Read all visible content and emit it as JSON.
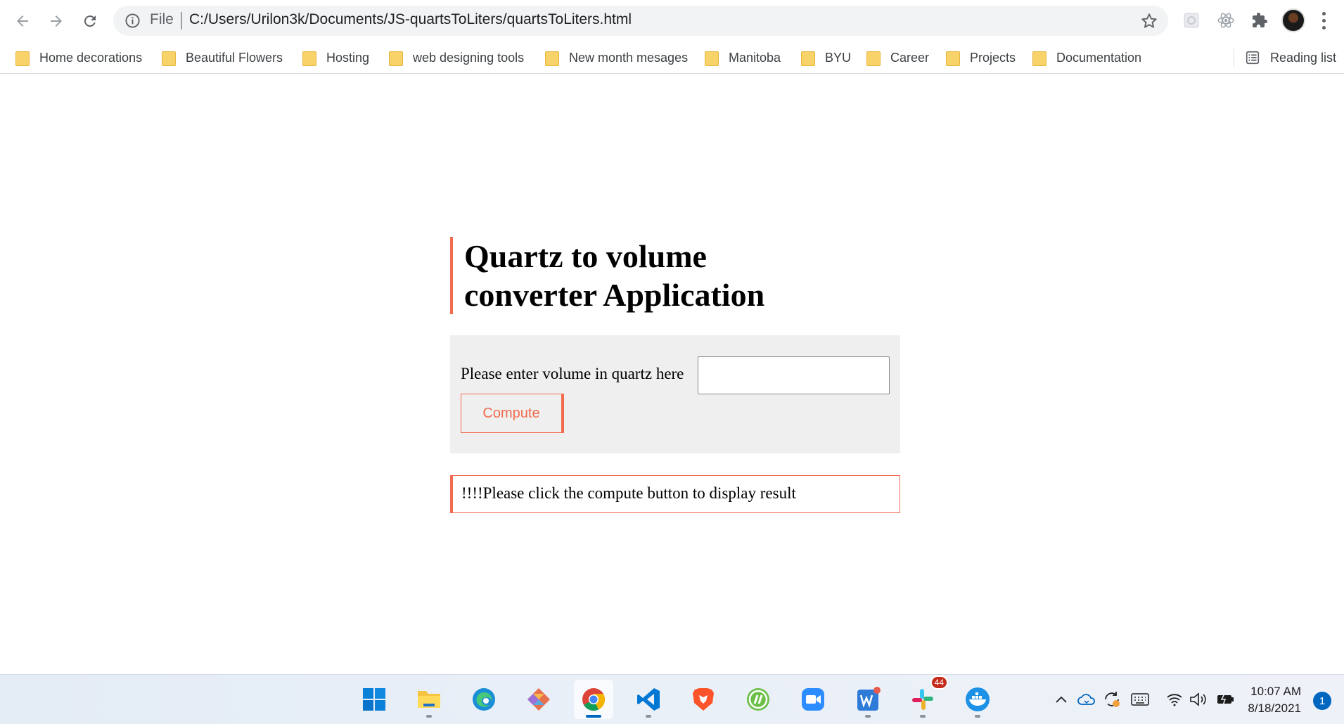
{
  "browser": {
    "omnibox": {
      "scheme_label": "File",
      "url": "C:/Users/Urilon3k/Documents/JS-quartsToLiters/quartsToLiters.html"
    },
    "bookmarks": [
      {
        "label": "Home decorations"
      },
      {
        "label": "Beautiful Flowers"
      },
      {
        "label": "Hosting"
      },
      {
        "label": "web designing tools"
      },
      {
        "label": "New month mesages"
      },
      {
        "label": "Manitoba"
      },
      {
        "label": "BYU"
      },
      {
        "label": "Career"
      },
      {
        "label": "Projects"
      },
      {
        "label": "Documentation"
      }
    ],
    "reading_list_label": "Reading list"
  },
  "page": {
    "title": "Quartz to volume converter Application",
    "form": {
      "label": "Please enter volume in quartz here",
      "input_value": "",
      "compute_label": "Compute"
    },
    "result_text": "!!!!Please click the compute button to display result",
    "accent_color": "#f26b4f"
  },
  "taskbar": {
    "apps": [
      "start-icon",
      "file-explorer-icon",
      "edge-icon",
      "git-icon",
      "chrome-icon",
      "vscode-icon",
      "brave-icon",
      "app-icon",
      "zoom-icon",
      "wps-icon",
      "slack-icon",
      "docker-icon"
    ],
    "slack_badge": "44",
    "clock_time": "10:07 AM",
    "clock_date": "8/18/2021",
    "notification_count": "1"
  }
}
